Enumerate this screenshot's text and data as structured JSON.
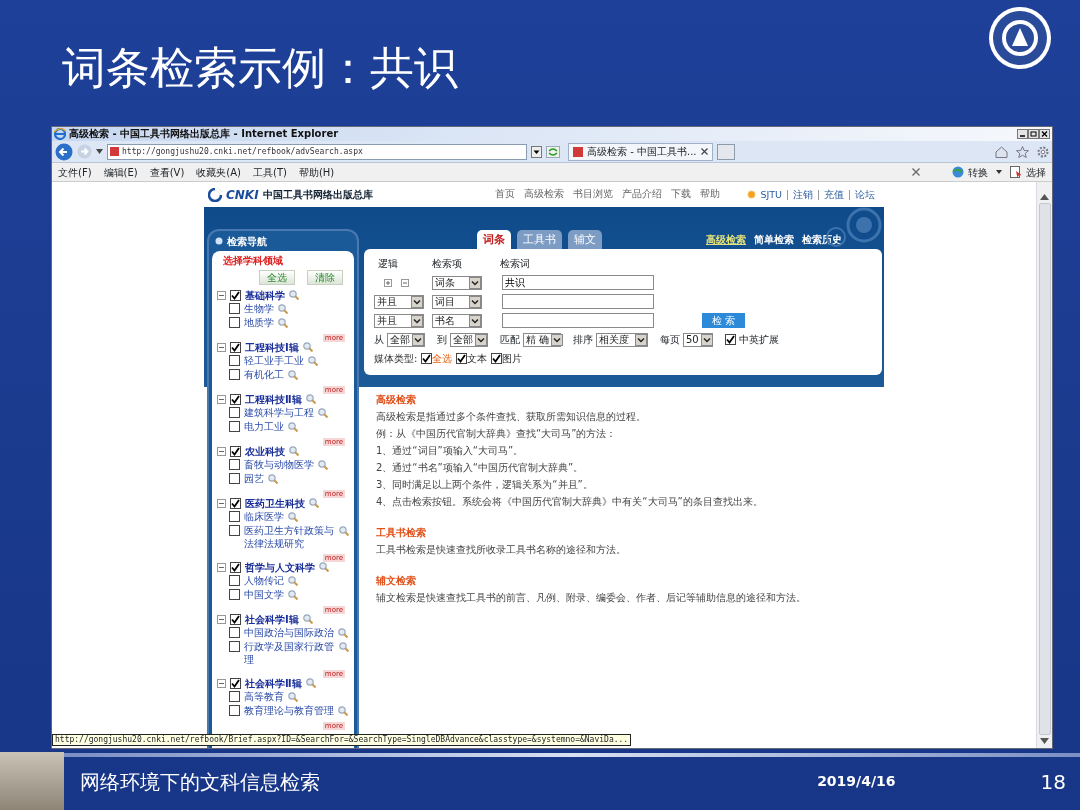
{
  "slide": {
    "title": "词条检索示例：共识",
    "footer_title": "网络环境下的文科信息检索",
    "date": "2019/4/16",
    "page_number": "18"
  },
  "browser": {
    "window_title": "高级检索 - 中国工具书网络出版总库 - Internet Explorer",
    "address": "http://gongjushu20.cnki.net/refbook/advSearch.aspx",
    "tab_title": "高级检索 - 中国工具书...",
    "menu": [
      "文件(F)",
      "编辑(E)",
      "查看(V)",
      "收藏夹(A)",
      "工具(T)",
      "帮助(H)"
    ],
    "tools": [
      "转换",
      "选择"
    ],
    "status_url": "http://gongjushu20.cnki.net/refbook/Brief.aspx?ID=&SearchFor=&SearchType=SingleDBAdvance&classtype=&systemno=&NaviDa..."
  },
  "site": {
    "logo_mark": "CNKI",
    "logo_text": "中国工具书网络出版总库",
    "nav": [
      "首页",
      "高级检索",
      "书目浏览",
      "产品介绍",
      "下载",
      "帮助"
    ],
    "user_links": [
      "SJTU",
      "注销",
      "充值",
      "论坛"
    ]
  },
  "sidebar": {
    "title": "检索导航",
    "subtitle": "选择学科领域",
    "buttons": [
      "全选",
      "清除"
    ],
    "groups": [
      {
        "label": "基础科学",
        "checked": true,
        "more": "more",
        "children": [
          {
            "label": "生物学",
            "checked": false
          },
          {
            "label": "地质学",
            "checked": false
          }
        ]
      },
      {
        "label": "工程科技Ⅰ辑",
        "checked": true,
        "more": "more",
        "children": [
          {
            "label": "轻工业手工业",
            "checked": false
          },
          {
            "label": "有机化工",
            "checked": false
          }
        ]
      },
      {
        "label": "工程科技Ⅱ辑",
        "checked": true,
        "more": "more",
        "children": [
          {
            "label": "建筑科学与工程",
            "checked": false
          },
          {
            "label": "电力工业",
            "checked": false
          }
        ]
      },
      {
        "label": "农业科技",
        "checked": true,
        "more": "more",
        "children": [
          {
            "label": "畜牧与动物医学",
            "checked": false
          },
          {
            "label": "园艺",
            "checked": false
          }
        ]
      },
      {
        "label": "医药卫生科技",
        "checked": true,
        "more": "more",
        "children": [
          {
            "label": "临床医学",
            "checked": false
          },
          {
            "label": "医药卫生方针政策与法律法规研究",
            "checked": false
          }
        ]
      },
      {
        "label": "哲学与人文科学",
        "checked": true,
        "more": "more",
        "children": [
          {
            "label": "人物传记",
            "checked": false
          },
          {
            "label": "中国文学",
            "checked": false
          }
        ]
      },
      {
        "label": "社会科学Ⅰ辑",
        "checked": true,
        "more": "more",
        "children": [
          {
            "label": "中国政治与国际政治",
            "checked": false
          },
          {
            "label": "行政学及国家行政管理",
            "checked": false
          }
        ]
      },
      {
        "label": "社会科学Ⅱ辑",
        "checked": true,
        "more": "more",
        "children": [
          {
            "label": "高等教育",
            "checked": false
          },
          {
            "label": "教育理论与教育管理",
            "checked": false
          }
        ]
      }
    ]
  },
  "search": {
    "tabs": [
      {
        "label": "词条",
        "selected": true
      },
      {
        "label": "工具书",
        "selected": false
      },
      {
        "label": "辅文",
        "selected": false
      }
    ],
    "modes": [
      {
        "label": "高级检索",
        "selected": true
      },
      {
        "label": "简单检索",
        "selected": false
      },
      {
        "label": "检索历史",
        "selected": false
      }
    ],
    "columns": [
      "逻辑",
      "检索项",
      "检索词"
    ],
    "rows": [
      {
        "kind": "first",
        "field": "词条",
        "term": "共识"
      },
      {
        "kind": "condition",
        "logic": "并且",
        "field": "词目"
      },
      {
        "kind": "condition",
        "logic": "并且",
        "field": "书名"
      }
    ],
    "search_button": "检 索",
    "filters": [
      {
        "label": "从",
        "value": "全部"
      },
      {
        "label": "到",
        "value": "全部"
      },
      {
        "label": "匹配",
        "value": "精 确"
      },
      {
        "label": "排序",
        "value": "相关度"
      },
      {
        "label": "每页",
        "value": "50"
      }
    ],
    "expand": {
      "label": "中英扩展",
      "checked": true
    },
    "media": {
      "label": "媒体类型:",
      "options": [
        {
          "kind": "select-all",
          "label": "全选",
          "checked": true
        },
        {
          "kind": "type",
          "label": "文本",
          "checked": true
        },
        {
          "kind": "type",
          "label": "图片",
          "checked": true
        }
      ]
    }
  },
  "help": [
    {
      "heading": "高级检索",
      "lines": [
        "高级检索是指通过多个条件查找、获取所需知识信息的过程。",
        "例：从《中国历代官制大辞典》查找“大司马”的方法：",
        "1、通过“词目”项输入“大司马”。",
        "2、通过“书名”项输入“中国历代官制大辞典”。",
        "3、同时满足以上两个条件，逻辑关系为“并且”。",
        "4、点击检索按钮。系统会将《中国历代官制大辞典》中有关“大司马”的条目查找出来。"
      ]
    },
    {
      "heading": "工具书检索",
      "lines": [
        "工具书检索是快速查找所收录工具书名称的途径和方法。"
      ]
    },
    {
      "heading": "辅文检索",
      "lines": [
        "辅文检索是快速查找工具书的前言、凡例、附录、编委会、作者、后记等辅助信息的途径和方法。"
      ]
    }
  ]
}
